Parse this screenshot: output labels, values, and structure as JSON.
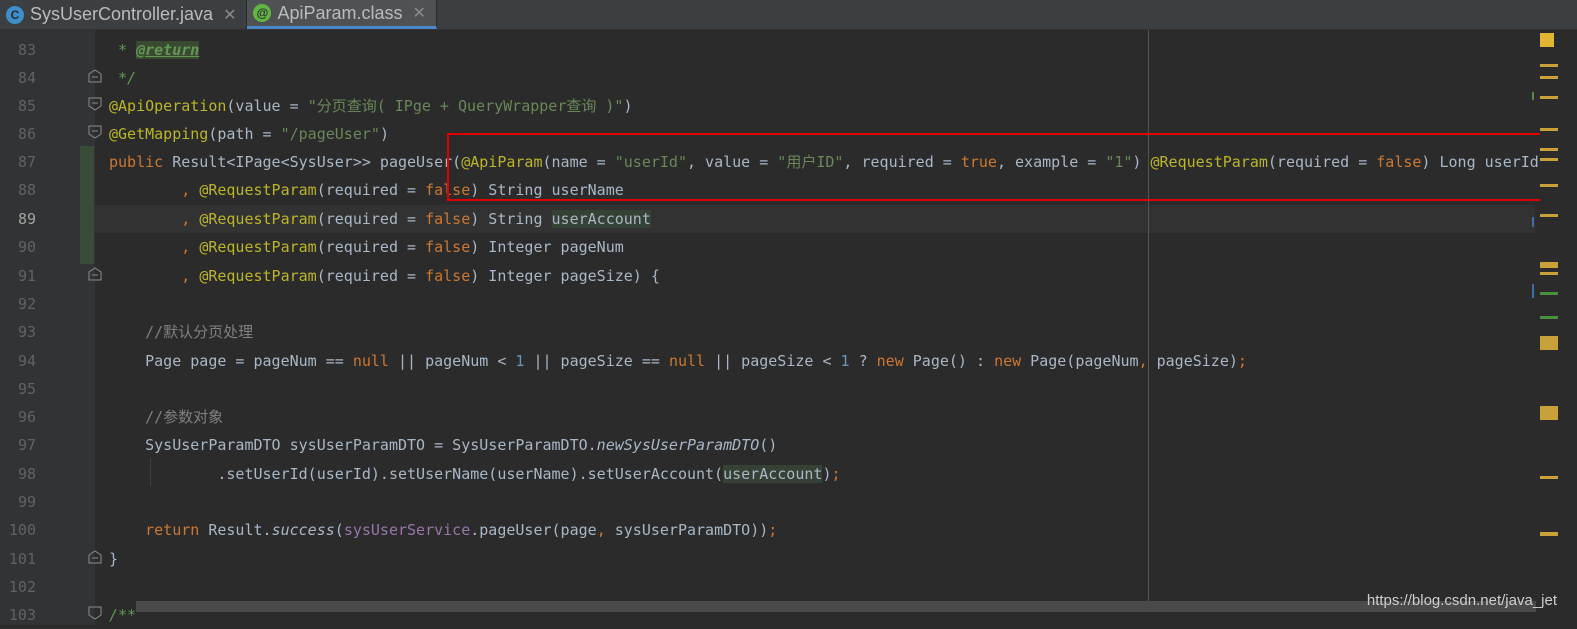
{
  "tabs": [
    {
      "icon": "C",
      "label": "SysUserController.java",
      "close": "✕",
      "active": false
    },
    {
      "icon": "@",
      "label": "ApiParam.class",
      "close": "✕",
      "active": true
    }
  ],
  "line_numbers": [
    "83",
    "84",
    "85",
    "86",
    "87",
    "88",
    "89",
    "90",
    "91",
    "92",
    "93",
    "94",
    "95",
    "96",
    "97",
    "98",
    "99",
    "100",
    "101",
    "102",
    "103"
  ],
  "code": {
    "l83_star": " * ",
    "l83_tag": "@return",
    "l84": " */",
    "l85_ann": "@ApiOperation",
    "l85_a": "(value = ",
    "l85_str": "\"分页查询( IPge + QueryWrapper查询 )\"",
    "l85_b": ")",
    "l86_ann": "@GetMapping",
    "l86_a": "(path = ",
    "l86_str": "\"/pageUser\"",
    "l86_b": ")",
    "l87_kw": "public",
    "l87_a": " Result<IPage<SysUser>> pageUser(",
    "l87_ann1": "@ApiParam",
    "l87_b": "(name = ",
    "l87_s1": "\"userId\"",
    "l87_c": ", value = ",
    "l87_s2": "\"用户ID\"",
    "l87_d": ", required = ",
    "l87_true": "true",
    "l87_e": ", example = ",
    "l87_s3": "\"1\"",
    "l87_f": ") ",
    "l87_ann2": "@RequestParam",
    "l87_g": "(required = ",
    "l87_false": "false",
    "l87_h": ") Long userId",
    "comma": "        , ",
    "reqparam": "@RequestParam",
    "req_a": "(required = ",
    "false": "false",
    "l88_end": ") String userName",
    "l89_end": ") String ",
    "l89_var": "userAccount",
    "l90_end": ") Integer pageNum",
    "l91_end": ") Integer pageSize) {",
    "l93": "    //默认分页处理",
    "l94_a": "    Page page = pageNum == ",
    "null": "null",
    "l94_b": " || pageNum < ",
    "one": "1",
    "l94_c": " || pageSize == ",
    "l94_d": " || pageSize < ",
    "l94_e": " ? ",
    "new": "new",
    "l94_f": " Page() : ",
    "l94_g": " Page(pageNum",
    "l94_comma": ",",
    "l94_h": " pageSize)",
    "semi": ";",
    "l96": "    //参数对象",
    "l97_a": "    SysUserParamDTO sysUserParamDTO = SysUserParamDTO.",
    "l97_m": "newSysUserParamDTO",
    "l97_b": "()",
    "l98_a": "            .setUserId(userId).setUserName(userName).setUserAccount(",
    "l98_var": "userAccount",
    "l98_b": ")",
    "l100_kw": "    return",
    "l100_a": " Result.",
    "l100_m": "success",
    "l100_b": "(",
    "l100_fld": "sysUserService",
    "l100_c": ".pageUser(page",
    "l100_comma": ",",
    "l100_d": " sysUserParamDTO))",
    "l101": "}",
    "l103": "/**"
  },
  "watermark": "https://blog.csdn.net/java_jet",
  "colors": {
    "keyword": "#cc7832",
    "annotation": "#bbb529",
    "string": "#6a8759",
    "number": "#6897bb",
    "highlight_box": "#e00000"
  }
}
